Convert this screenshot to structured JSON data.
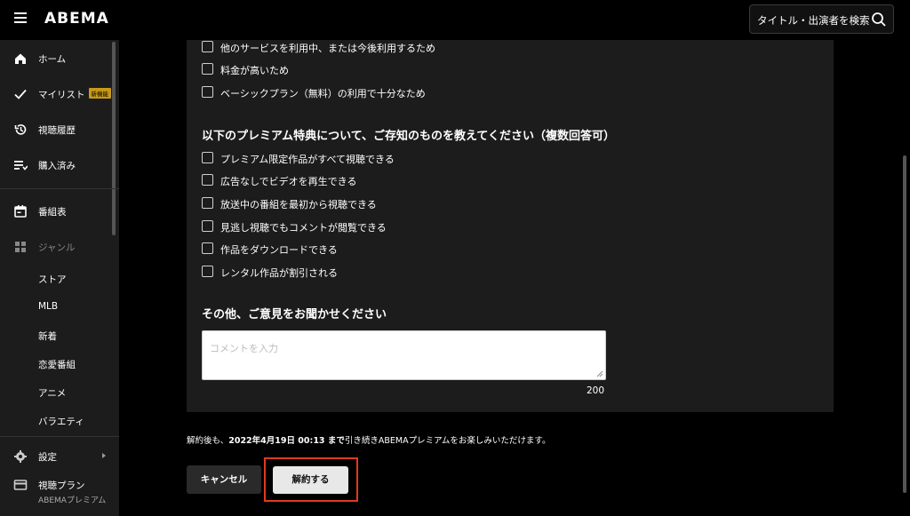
{
  "header": {
    "logo": "ABEMA",
    "search_label": "タイトル・出演者を検索"
  },
  "sidebar": {
    "items": [
      {
        "label": "ホーム",
        "icon": "home-icon"
      },
      {
        "label": "マイリスト",
        "icon": "check-icon",
        "badge": "新機能"
      },
      {
        "label": "視聴履歴",
        "icon": "history-icon"
      },
      {
        "label": "購入済み",
        "icon": "purchased-icon"
      },
      {
        "label": "番組表",
        "icon": "calendar-icon"
      },
      {
        "label": "ジャンル",
        "icon": "grid-icon"
      }
    ],
    "genres": [
      "ストア",
      "MLB",
      "新着",
      "恋愛番組",
      "アニメ",
      "バラエティ"
    ],
    "settings_label": "設定",
    "plan_label": "視聴プラン",
    "plan_value": "ABEMAプレミアム"
  },
  "form": {
    "reasons": [
      "他のサービスを利用中、または今後利用するため",
      "料金が高いため",
      "ベーシックプラン（無料）の利用で十分なため"
    ],
    "benefits_title": "以下のプレミアム特典について、ご存知のものを教えてください（複数回答可）",
    "benefits": [
      "プレミアム限定作品がすべて視聴できる",
      "広告なしでビデオを再生できる",
      "放送中の番組を最初から視聴できる",
      "見逃し視聴でもコメントが閲覧できる",
      "作品をダウンロードできる",
      "レンタル作品が割引される"
    ],
    "opinion_title": "その他、ご意見をお聞かせください",
    "comment_placeholder": "コメントを入力",
    "char_limit": "200"
  },
  "notice": {
    "prefix": "解約後も、",
    "date": "2022年4月19日 00:13 まで",
    "suffix": "引き続きABEMAプレミアムをお楽しみいただけます。"
  },
  "buttons": {
    "cancel": "キャンセル",
    "unsubscribe": "解約する"
  },
  "colors": {
    "highlight": "#e03a1f",
    "badge": "#c79a1b"
  }
}
